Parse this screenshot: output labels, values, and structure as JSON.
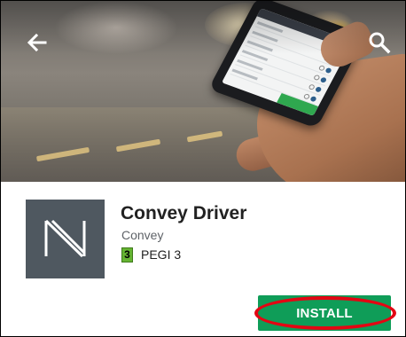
{
  "app": {
    "title": "Convey Driver",
    "developer": "Convey",
    "content_rating": {
      "badge": "3",
      "label": "PEGI 3",
      "badge_color": "#65b432"
    },
    "icon": {
      "name": "convey-n-logo",
      "background": "#4f5860"
    }
  },
  "toolbar": {
    "back_icon": "arrow-left-icon",
    "search_icon": "search-icon"
  },
  "actions": {
    "install_label": "INSTALL",
    "install_color": "#0f9d58"
  },
  "annotation": {
    "color": "#e30613"
  }
}
